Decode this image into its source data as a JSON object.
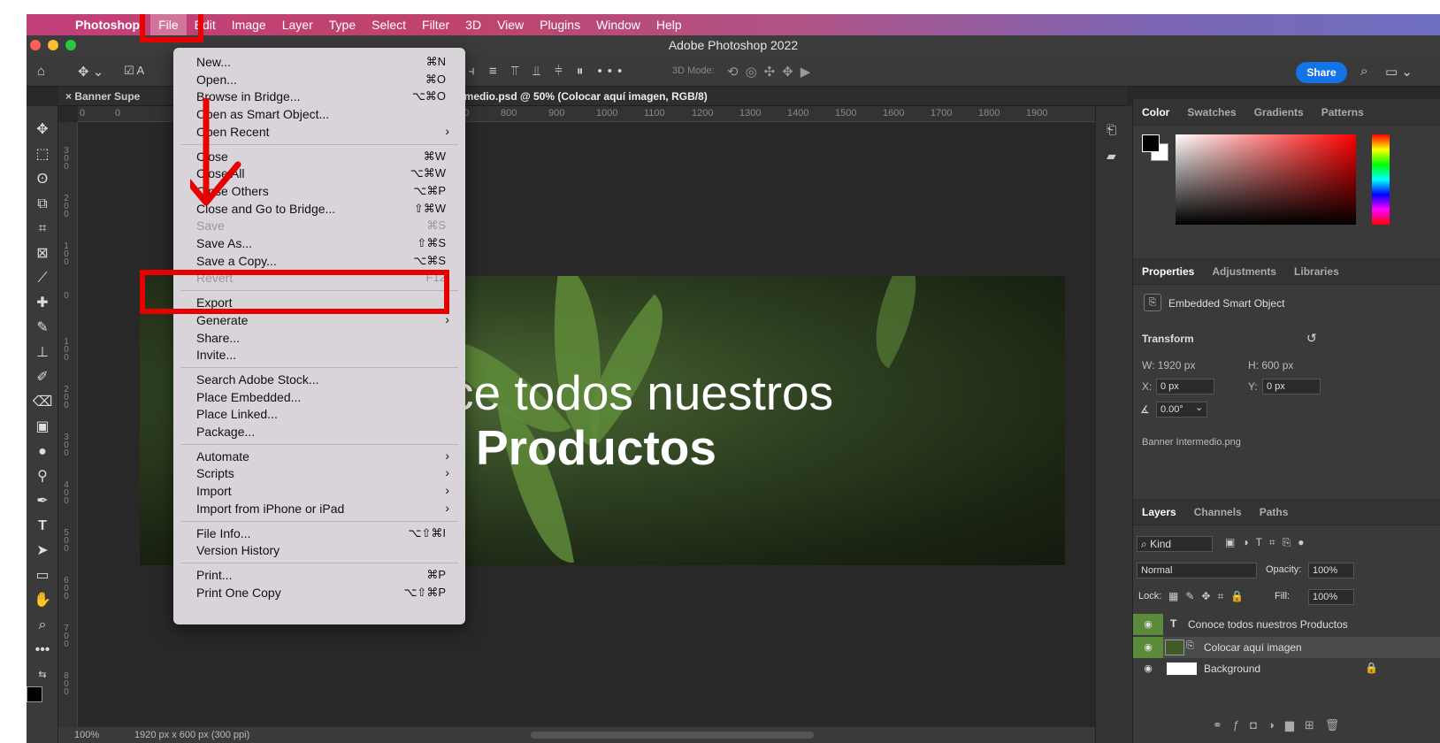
{
  "menubar": {
    "items": [
      "Photoshop",
      "File",
      "Edit",
      "Image",
      "Layer",
      "Type",
      "Select",
      "Filter",
      "3D",
      "View",
      "Plugins",
      "Window",
      "Help"
    ]
  },
  "window": {
    "title": "Adobe Photoshop 2022"
  },
  "options": {
    "mode_label": "3D Mode:",
    "share": "Share"
  },
  "tabs": {
    "tab1": "Banner Supe",
    "tab2": "ntermedio.psd @ 50% (Colocar aquí imagen, RGB/8)"
  },
  "ruler": {
    "marks": [
      "0",
      "0",
      "700",
      "800",
      "900",
      "1000",
      "1100",
      "1200",
      "1300",
      "1400",
      "1500",
      "1600",
      "1700",
      "1800",
      "1900"
    ]
  },
  "vruler": {
    "marks": [
      "3\n0\n0",
      "2\n0\n0",
      "1\n0\n0",
      "0",
      "1\n0\n0",
      "2\n0\n0",
      "3\n0\n0",
      "4\n0\n0",
      "5\n0\n0",
      "6\n0\n0",
      "7\n0\n0",
      "8\n0\n0"
    ]
  },
  "canvas": {
    "line1": "ce todos nuestros",
    "line2": "Productos"
  },
  "status": {
    "zoom": "100%",
    "doc": "1920 px x 600 px (300 ppi)"
  },
  "file_menu": {
    "items": [
      {
        "label": "New...",
        "shortcut": "⌘N"
      },
      {
        "label": "Open...",
        "shortcut": "⌘O"
      },
      {
        "label": "Browse in Bridge...",
        "shortcut": "⌥⌘O"
      },
      {
        "label": "Open as Smart Object...",
        "shortcut": ""
      },
      {
        "label": "Open Recent",
        "shortcut": "",
        "submenu": true
      },
      {
        "sep": true
      },
      {
        "label": "Close",
        "shortcut": "⌘W"
      },
      {
        "label": "Close All",
        "shortcut": "⌥⌘W"
      },
      {
        "label": "Close Others",
        "shortcut": "⌥⌘P"
      },
      {
        "label": "Close and Go to Bridge...",
        "shortcut": "⇧⌘W"
      },
      {
        "label": "Save",
        "shortcut": "⌘S",
        "disabled": true
      },
      {
        "label": "Save As...",
        "shortcut": "⇧⌘S"
      },
      {
        "label": "Save a Copy...",
        "shortcut": "⌥⌘S"
      },
      {
        "label": "Revert",
        "shortcut": "F12",
        "disabled": true
      },
      {
        "sep": true
      },
      {
        "label": "Export",
        "shortcut": "",
        "submenu": true
      },
      {
        "label": "Generate",
        "shortcut": "",
        "submenu": true
      },
      {
        "label": "Share...",
        "shortcut": ""
      },
      {
        "label": "Invite...",
        "shortcut": ""
      },
      {
        "sep": true
      },
      {
        "label": "Search Adobe Stock...",
        "shortcut": ""
      },
      {
        "label": "Place Embedded...",
        "shortcut": ""
      },
      {
        "label": "Place Linked...",
        "shortcut": ""
      },
      {
        "label": "Package...",
        "shortcut": ""
      },
      {
        "sep": true
      },
      {
        "label": "Automate",
        "shortcut": "",
        "submenu": true
      },
      {
        "label": "Scripts",
        "shortcut": "",
        "submenu": true
      },
      {
        "label": "Import",
        "shortcut": "",
        "submenu": true
      },
      {
        "label": "Import from iPhone or iPad",
        "shortcut": "",
        "submenu": true
      },
      {
        "sep": true
      },
      {
        "label": "File Info...",
        "shortcut": "⌥⇧⌘I"
      },
      {
        "label": "Version History",
        "shortcut": ""
      },
      {
        "sep": true
      },
      {
        "label": "Print...",
        "shortcut": "⌘P"
      },
      {
        "label": "Print One Copy",
        "shortcut": "⌥⇧⌘P"
      }
    ]
  },
  "color_panel": {
    "tabs": [
      "Color",
      "Swatches",
      "Gradients",
      "Patterns"
    ]
  },
  "properties_panel": {
    "tabs": [
      "Properties",
      "Adjustments",
      "Libraries"
    ],
    "kind": "Embedded Smart Object",
    "transform_label": "Transform",
    "w": "W: 1920 px",
    "h": "H: 600 px",
    "x_label": "X:",
    "x_value": "0 px",
    "y_label": "Y:",
    "y_value": "0 px",
    "angle": "0.00°",
    "file": "Banner Intermedio.png"
  },
  "layers_panel": {
    "tabs": [
      "Layers",
      "Channels",
      "Paths"
    ],
    "filter": "Kind",
    "blend": "Normal",
    "opacity_label": "Opacity:",
    "opacity": "100%",
    "lock_label": "Lock:",
    "fill_label": "Fill:",
    "fill": "100%",
    "layers": [
      {
        "name": "Conoce todos nuestros Productos"
      },
      {
        "name": "Colocar aquí imagen"
      },
      {
        "name": "Background"
      }
    ]
  },
  "colors": {
    "accent_annotation": "#e60000",
    "share_blue": "#1473e6"
  }
}
